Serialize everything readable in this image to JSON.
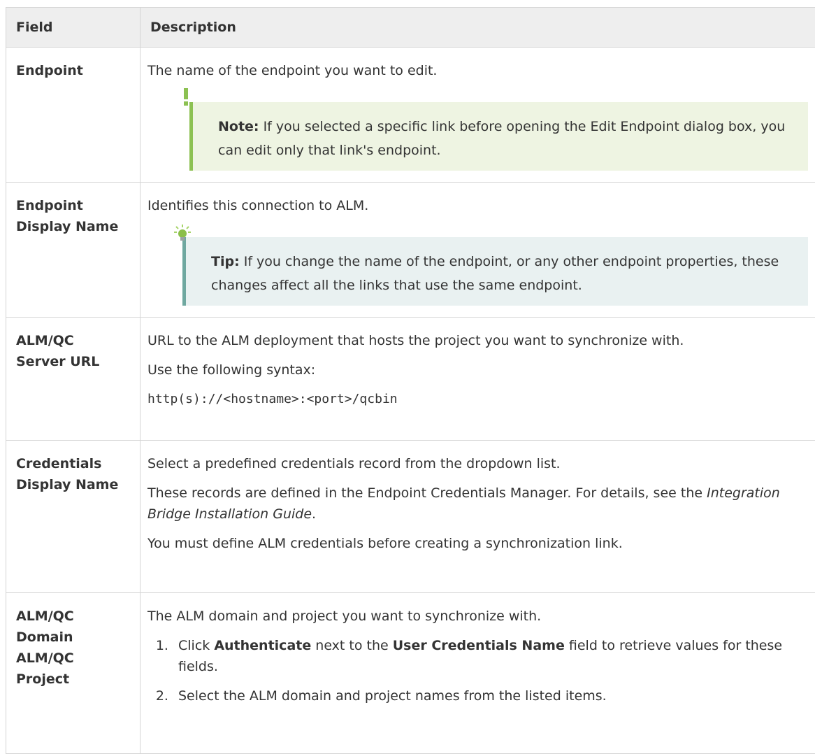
{
  "table": {
    "headers": {
      "field": "Field",
      "description": "Description"
    },
    "rows": [
      {
        "field": "Endpoint",
        "description": "The name of the endpoint you want to edit.",
        "note": {
          "label": "Note:",
          "text": " If you selected a specific link before opening the Edit Endpoint dialog box, you can edit only that link's endpoint."
        }
      },
      {
        "field_line1": "Endpoint",
        "field_line2": "Display Name",
        "description": "Identifies this connection to ALM.",
        "tip": {
          "label": "Tip:",
          "text": " If you change the name of the endpoint, or any other endpoint properties, these changes affect all the links that use the same endpoint."
        }
      },
      {
        "field_line1": "ALM/QC",
        "field_line2": "Server URL",
        "p1": "URL to the ALM deployment that hosts the project you want to synchronize with.",
        "p2": "Use the following syntax:",
        "code": "http(s)://<hostname>:<port>/qcbin"
      },
      {
        "field_line1": "Credentials",
        "field_line2": "Display Name",
        "p1": "Select a predefined credentials record from the dropdown list.",
        "p2_text": "These records are defined in the Endpoint Credentials Manager. For details, see the ",
        "p2_italic": "Integration Bridge Installation Guide",
        "p2_end": ".",
        "p3": "You must define ALM credentials before creating a synchronization link."
      },
      {
        "field_line1": "ALM/QC",
        "field_line2": "Domain",
        "field_line3": "ALM/QC",
        "field_line4": "Project",
        "p1": "The ALM domain and project you want to synchronize with.",
        "step1": {
          "t1": "Click ",
          "b1": "Authenticate",
          "t2": " next to the ",
          "b2": "User Credentials Name",
          "t3": " field to retrieve values for these fields."
        },
        "step2": "Select the ALM domain and project names from the listed items."
      }
    ]
  },
  "colors": {
    "header_bg": "#eeeeee",
    "note_bg": "#eef4e2",
    "note_bar": "#8cc152",
    "tip_bg": "#e9f1f1",
    "tip_bar": "#6fa8a0",
    "border": "#d4d4d4"
  },
  "icons": {
    "note": "exclamation-note-icon",
    "tip": "lightbulb-tip-icon"
  }
}
